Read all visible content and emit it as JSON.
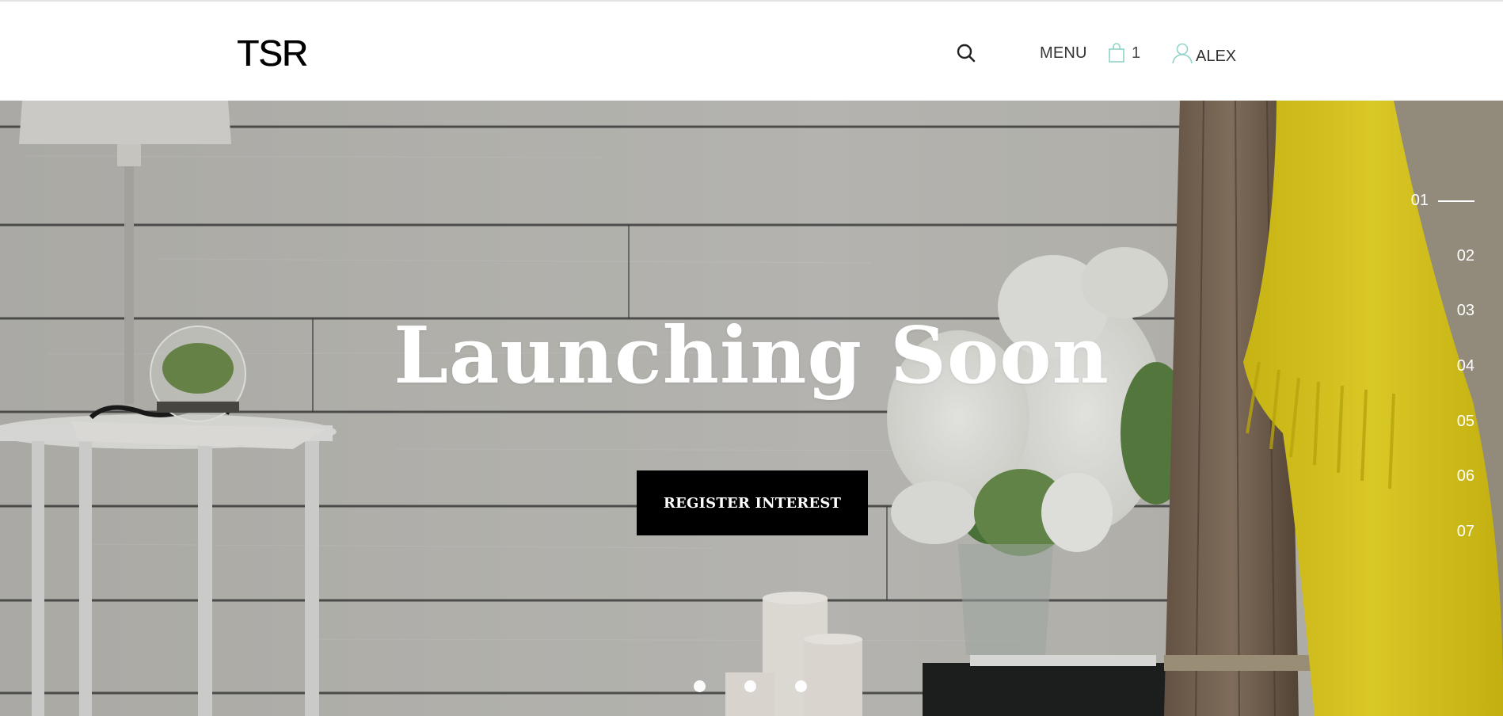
{
  "header": {
    "logo": "TSR",
    "search_icon": "search-icon",
    "menu_label": "MENU",
    "cart_icon": "shopping-bag-icon",
    "cart_count": "1",
    "account_icon": "user-icon",
    "account_name": "ALEX",
    "accent_color": "#8fd3c9"
  },
  "hero": {
    "title": "Launching Soon",
    "cta_label": "REGISTER INTEREST",
    "slides": [
      {
        "label": "01",
        "active": true
      },
      {
        "label": "02",
        "active": false
      },
      {
        "label": "03",
        "active": false
      },
      {
        "label": "04",
        "active": false
      },
      {
        "label": "05",
        "active": false
      },
      {
        "label": "06",
        "active": false
      },
      {
        "label": "07",
        "active": false
      }
    ],
    "dots_count": 3
  }
}
